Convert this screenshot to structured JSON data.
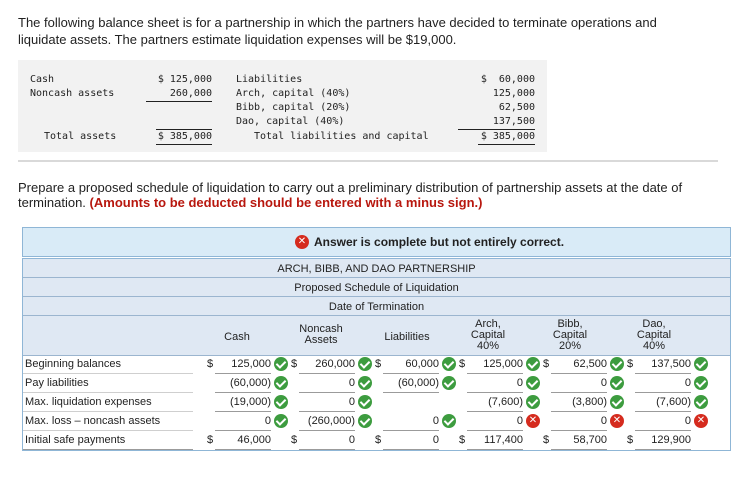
{
  "intro": "The following balance sheet is for a partnership in which the partners have decided to terminate operations and liquidate assets. The partners estimate liquidation expenses will be $19,000.",
  "balance_sheet": {
    "cash_label": "Cash",
    "cash_value": "$ 125,000",
    "noncash_label": "Noncash assets",
    "noncash_value": "260,000",
    "total_assets_label": "Total assets",
    "total_assets_value": "$ 385,000",
    "liabilities_label": "Liabilities",
    "arch_label": "Arch, capital (40%)",
    "bibb_label": "Bibb, capital (20%)",
    "dao_label": "Dao, capital (40%)",
    "total_lc_label": "Total liabilities and capital",
    "liabilities_value": "$  60,000",
    "arch_value": "125,000",
    "bibb_value": "62,500",
    "dao_value": "137,500",
    "total_lc_value": "$ 385,000"
  },
  "instruction_main": "Prepare a proposed schedule of liquidation to carry out a preliminary distribution of partnership assets at the date of termination.",
  "instruction_red": "(Amounts to be deducted should be entered with a minus sign.)",
  "answer_status": "Answer is complete but not entirely correct.",
  "table": {
    "title1": "ARCH, BIBB, AND DAO PARTNERSHIP",
    "title2": "Proposed Schedule of Liquidation",
    "title3": "Date of Termination",
    "col_cash": "Cash",
    "col_noncash_1": "Noncash",
    "col_noncash_2": "Assets",
    "col_liabilities": "Liabilities",
    "col_arch_1": "Arch,",
    "col_arch_2": "Capital",
    "col_arch_3": "40%",
    "col_bibb_1": "Bibb,",
    "col_bibb_2": "Capital",
    "col_bibb_3": "20%",
    "col_dao_1": "Dao,",
    "col_dao_2": "Capital",
    "col_dao_3": "40%",
    "dollar": "$",
    "rows": [
      {
        "label": "Beginning balances",
        "cash": "125,000",
        "noncash": "260,000",
        "liab": "60,000",
        "arch": "125,000",
        "bibb": "62,500",
        "dao": "137,500"
      },
      {
        "label": "Pay liabilities",
        "cash": "(60,000)",
        "noncash": "0",
        "liab": "(60,000)",
        "arch": "0",
        "bibb": "0",
        "dao": "0"
      },
      {
        "label": "Max. liquidation expenses",
        "cash": "(19,000)",
        "noncash": "0",
        "liab": "",
        "arch": "(7,600)",
        "bibb": "(3,800)",
        "dao": "(7,600)"
      },
      {
        "label": "Max. loss – noncash assets",
        "cash": "0",
        "noncash": "(260,000)",
        "liab": "0",
        "arch": "0",
        "bibb": "0",
        "dao": "0"
      },
      {
        "label": "Initial safe payments",
        "cash": "46,000",
        "noncash": "0",
        "liab": "0",
        "arch": "117,400",
        "bibb": "58,700",
        "dao": "129,900"
      }
    ]
  },
  "colors": {
    "check": "#3d9c3f",
    "error": "#d52b1e",
    "header_bg": "#dfe8f3",
    "answer_bg": "#d9ebf7",
    "warning_text": "#b8170e"
  }
}
